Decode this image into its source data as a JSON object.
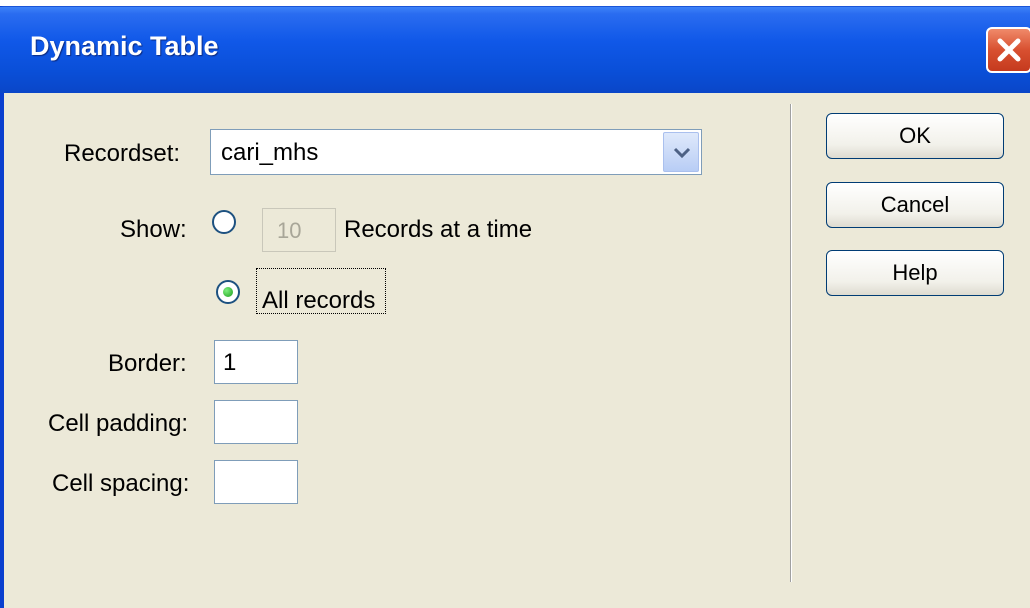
{
  "window": {
    "title": "Dynamic Table"
  },
  "icons": {
    "close": "close-icon",
    "dropdown": "chevron-down-icon"
  },
  "form": {
    "recordset_label": "Recordset:",
    "recordset_value": "cari_mhs",
    "show_label": "Show:",
    "records_count": "10",
    "records_at_a_time_label": "Records at a time",
    "all_records_label": "All records",
    "show_selected": "All records",
    "border_label": "Border:",
    "border_value": "1",
    "cell_padding_label": "Cell padding:",
    "cell_padding_value": "",
    "cell_spacing_label": "Cell spacing:",
    "cell_spacing_value": ""
  },
  "buttons": {
    "ok": "OK",
    "cancel": "Cancel",
    "help": "Help"
  },
  "colors": {
    "titlebar": "#0a4fd8",
    "dialog_bg": "#ece9d8",
    "close_button": "#d85030",
    "radio_selected": "#1c9c1c"
  }
}
